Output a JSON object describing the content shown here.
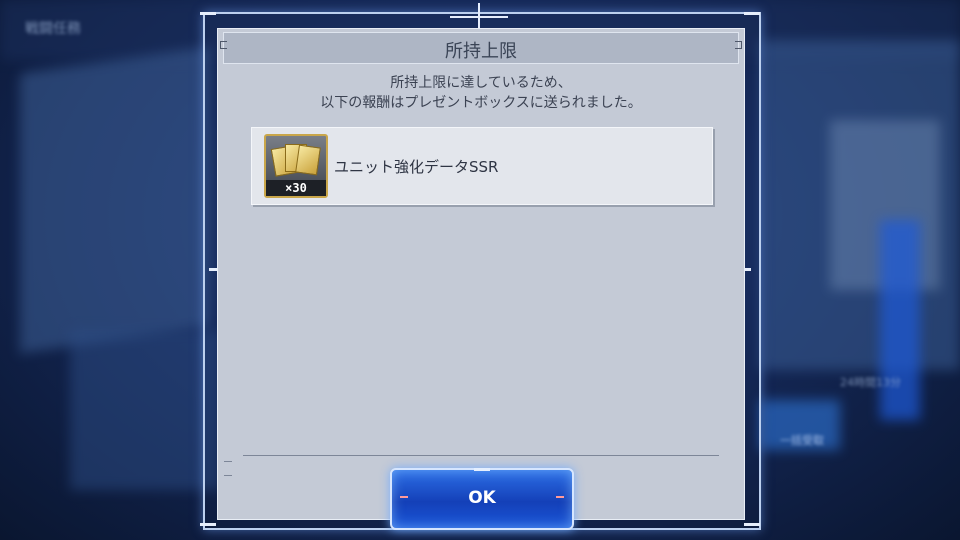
{
  "background": {
    "labels": [
      "戦闘任務",
      "24時間13分",
      "一括受取"
    ]
  },
  "dialog": {
    "title": "所持上限",
    "message_line1": "所持上限に達しているため、",
    "message_line2": "以下の報酬はプレゼントボックスに送られました。",
    "reward": {
      "icon": "unit-data-ssr-icon",
      "quantity": "×30",
      "name": "ユニット強化データSSR"
    },
    "ok_label": "OK"
  },
  "colors": {
    "panel": "#c4cad6",
    "title_bar": "#aeb6c5",
    "button": "#1f56d8",
    "frame": "#bcd0ef"
  }
}
